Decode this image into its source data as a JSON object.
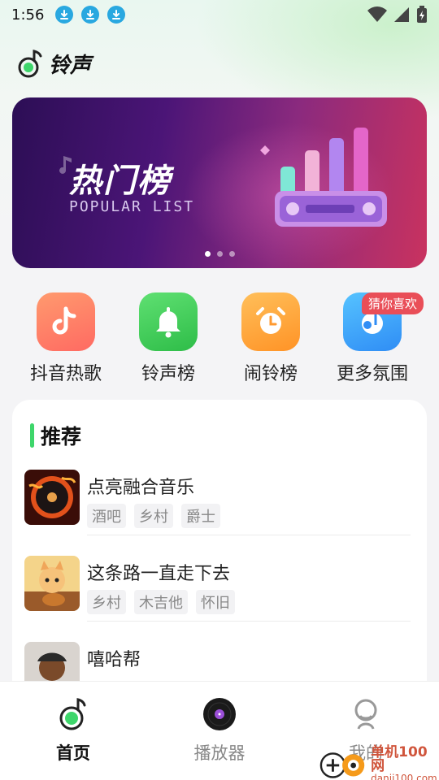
{
  "status_bar": {
    "time": "1:56"
  },
  "app": {
    "title": "铃声"
  },
  "banner": {
    "title": "热门榜",
    "subtitle": "POPULAR LIST"
  },
  "categories": [
    {
      "label": "抖音热歌",
      "icon": "tiktok-icon"
    },
    {
      "label": "铃声榜",
      "icon": "bell-icon"
    },
    {
      "label": "闹铃榜",
      "icon": "alarm-clock-icon"
    },
    {
      "label": "更多氛围",
      "icon": "music-disc-icon",
      "badge": "猜你喜欢"
    }
  ],
  "recommend": {
    "title": "推荐",
    "items": [
      {
        "name": "点亮融合音乐",
        "tags": [
          "酒吧",
          "乡村",
          "爵士"
        ]
      },
      {
        "name": "这条路一直走下去",
        "tags": [
          "乡村",
          "木吉他",
          "怀旧"
        ]
      },
      {
        "name": "嘻哈帮",
        "tags": []
      }
    ]
  },
  "tabbar": {
    "items": [
      {
        "label": "首页",
        "icon": "home-note-icon",
        "active": true
      },
      {
        "label": "播放器",
        "icon": "vinyl-icon",
        "active": false
      },
      {
        "label": "我的",
        "icon": "profile-icon",
        "active": false
      }
    ]
  },
  "watermark": {
    "name": "单机100网",
    "url": "danji100.com"
  },
  "colors": {
    "accent": "#3ed66b",
    "badge": "#e94e58"
  }
}
